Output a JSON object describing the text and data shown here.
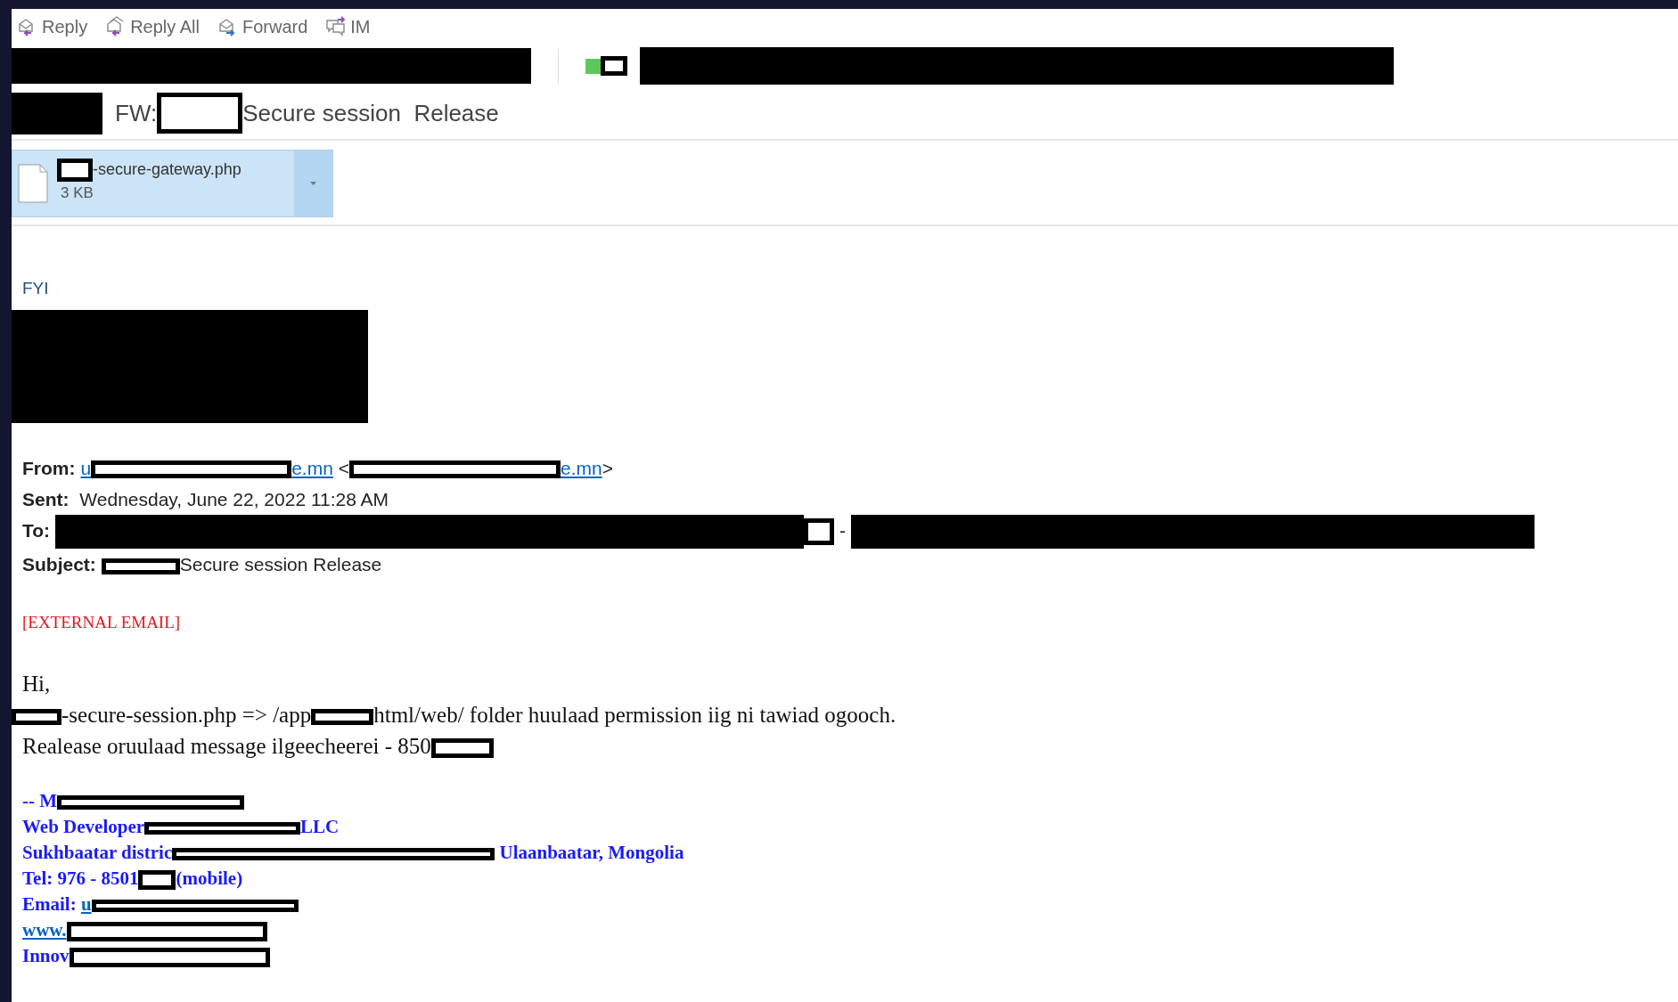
{
  "toolbar": [
    {
      "label": "Reply",
      "kind": "reply"
    },
    {
      "label": "Reply All",
      "kind": "replyall"
    },
    {
      "label": "Forward",
      "kind": "forward"
    },
    {
      "label": "IM",
      "kind": "im"
    }
  ],
  "subject": [
    {
      "kind": "redacted-fill"
    },
    {
      "kind": "text",
      "text": "FW:"
    },
    {
      "kind": "redacted-box"
    },
    {
      "kind": "text",
      "text": "Secure session  Release"
    }
  ],
  "attachment": {
    "name": [
      {
        "kind": "redacted-box"
      },
      {
        "kind": "text",
        "text": "-secure-gateway.php"
      }
    ],
    "size": "3 KB"
  },
  "note": "FYI",
  "header_fields": [
    {
      "label": "From:",
      "value": [
        {
          "kind": "link",
          "text": "u"
        },
        {
          "kind": "redacted-box"
        },
        {
          "kind": "link",
          "text": "e.mn"
        },
        {
          "kind": "text",
          "text": " <"
        },
        {
          "kind": "redacted-box"
        },
        {
          "kind": "link",
          "text": "e.mn"
        },
        {
          "kind": "text",
          "text": ">"
        }
      ]
    },
    {
      "label": "Sent:",
      "value": [
        {
          "kind": "text",
          "text": " Wednesday, June 22, 2022 11:28 AM"
        }
      ]
    },
    {
      "label": "To:",
      "value": [
        {
          "kind": "redacted-fill"
        },
        {
          "kind": "redacted-box"
        },
        {
          "kind": "text",
          "text": " - "
        },
        {
          "kind": "redacted-fill"
        }
      ]
    },
    {
      "label": "Subject:",
      "value": [
        {
          "kind": "redacted-box"
        },
        {
          "kind": "text",
          "text": "Secure session Release"
        }
      ]
    }
  ],
  "banner": "[EXTERNAL EMAIL]",
  "body": [
    [
      {
        "kind": "text",
        "text": "Hi,"
      }
    ],
    [
      {
        "kind": "redacted-box"
      },
      {
        "kind": "text",
        "text": "-secure-session.php => /app"
      },
      {
        "kind": "redacted-box"
      },
      {
        "kind": "text",
        "text": "html/web/ folder huulaad permission iig ni tawiad ogooch."
      }
    ],
    [
      {
        "kind": "text",
        "text": "Realease oruulaad message ilgeecheerei - 850"
      },
      {
        "kind": "redacted-box"
      }
    ]
  ],
  "signature": [
    [
      {
        "kind": "text",
        "text": "-- M"
      },
      {
        "kind": "redacted-box"
      }
    ],
    [
      {
        "kind": "text",
        "text": "Web Developer"
      },
      {
        "kind": "redacted-box"
      },
      {
        "kind": "text",
        "text": "LLC"
      }
    ],
    [
      {
        "kind": "text",
        "text": "Sukhbaatar distric"
      },
      {
        "kind": "redacted-box"
      },
      {
        "kind": "text",
        "text": " Ulaanbaatar, Mongolia"
      }
    ],
    [
      {
        "kind": "text",
        "text": "Tel: 976 - 8501"
      },
      {
        "kind": "redacted-box"
      },
      {
        "kind": "text",
        "text": "(mobile)"
      }
    ],
    [
      {
        "kind": "text",
        "text": "Email: "
      },
      {
        "kind": "link",
        "text": "u"
      },
      {
        "kind": "redacted-box"
      }
    ],
    [
      {
        "kind": "link",
        "text": "www."
      },
      {
        "kind": "redacted-box"
      }
    ],
    [
      {
        "kind": "text",
        "text": "Innov"
      },
      {
        "kind": "redacted-box"
      }
    ]
  ]
}
